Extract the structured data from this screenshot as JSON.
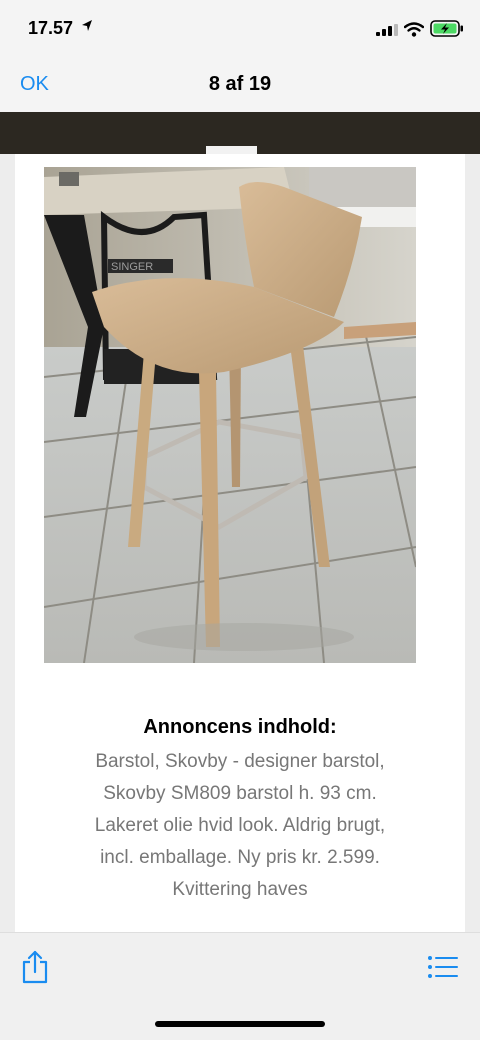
{
  "status_bar": {
    "time": "17.57"
  },
  "nav": {
    "ok_label": "OK",
    "title": "8 af 19"
  },
  "listing": {
    "heading": "Annoncens indhold:",
    "description_lines": [
      "Barstol, Skovby - designer barstol,",
      "Skovby SM809 barstol h. 93 cm.",
      "Lakeret olie hvid look. Aldrig brugt,",
      "incl. emballage. Ny pris kr. 2.599.",
      "Kvittering haves"
    ]
  },
  "sewing_machine_brand": "SINGER",
  "colors": {
    "accent": "#1a8cf0",
    "battery_charge": "#4cd964"
  }
}
